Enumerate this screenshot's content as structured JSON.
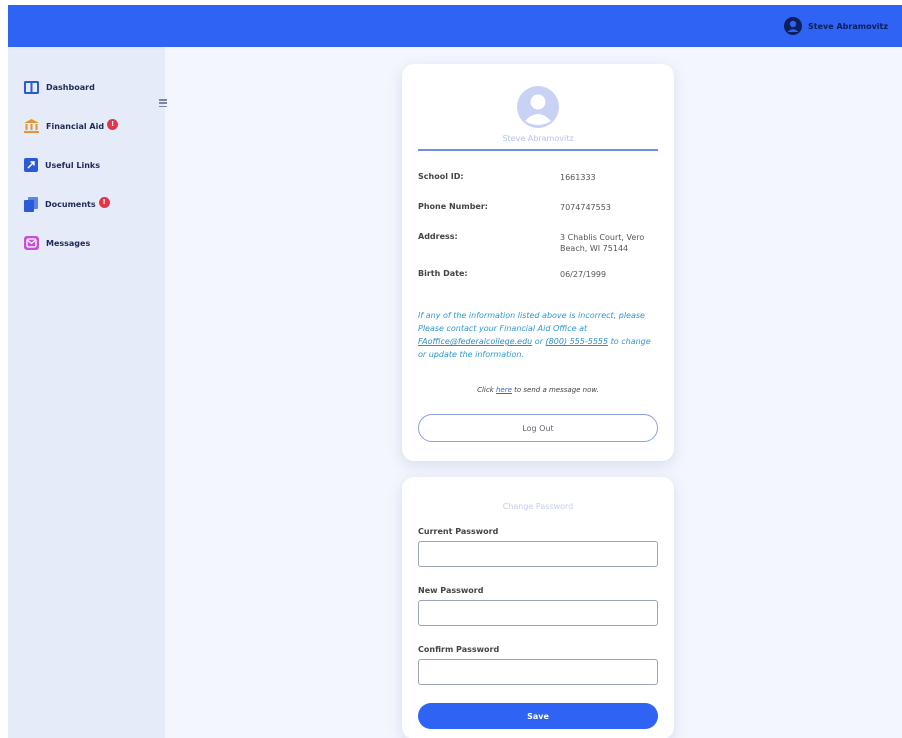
{
  "header": {
    "user_name": "Steve Abramovitz"
  },
  "sidebar": {
    "items": [
      {
        "label": "Dashboard"
      },
      {
        "label": "Financial Aid",
        "badge": "!"
      },
      {
        "label": "Useful Links"
      },
      {
        "label": "Documents",
        "badge": "!"
      },
      {
        "label": "Messages"
      }
    ]
  },
  "profile": {
    "name": "Steve Abramovitz",
    "rows": [
      {
        "label": "School ID:",
        "value": "1661333"
      },
      {
        "label": "Phone Number:",
        "value": "7074747553"
      },
      {
        "label": "Address:",
        "value": "3 Chablis Court, Vero Beach, WI 75144"
      },
      {
        "label": "Birth Date:",
        "value": "06/27/1999"
      }
    ],
    "notice_pre": "If any of the information listed above is incorrect, please Please contact your Financial Aid Office at ",
    "notice_email": "FAoffice@federalcollege.edu",
    "notice_mid": " or ",
    "notice_phone": "(800) 555-5555",
    "notice_post": " to change or update the information.",
    "click_pre": "Click ",
    "click_link": "here",
    "click_post": " to send a message now.",
    "logout_label": "Log Out"
  },
  "password": {
    "title": "Change Password",
    "current_label": "Current Password",
    "current_value": "",
    "new_label": "New Password",
    "new_value": "",
    "confirm_label": "Confirm Password",
    "confirm_value": "",
    "save_label": "Save"
  },
  "colors": {
    "primary": "#2f63f4",
    "sidebar_bg": "#e6ebf9",
    "badge": "#e2374a",
    "notice_text": "#2e98d1"
  }
}
